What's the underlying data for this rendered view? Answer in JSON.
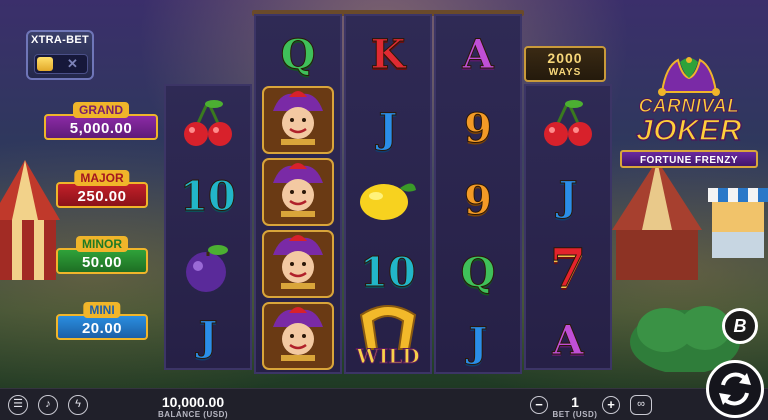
{
  "game": {
    "logo": {
      "line1": "CARNIVAL",
      "line2": "JOKER",
      "subtitle": "FORTUNE FRENZY"
    },
    "ways": {
      "count": "2000",
      "label": "WAYS"
    },
    "xtra_bet": {
      "title": "XTRA-BET",
      "enabled": false
    },
    "jackpots": [
      {
        "name": "GRAND",
        "value": "5,000.00"
      },
      {
        "name": "MAJOR",
        "value": "250.00"
      },
      {
        "name": "MINOR",
        "value": "50.00"
      },
      {
        "name": "MINI",
        "value": "20.00"
      }
    ],
    "reels": [
      [
        "cherries",
        "10",
        "plum",
        "J"
      ],
      [
        "Q",
        "joker",
        "joker",
        "joker",
        "joker"
      ],
      [
        "K",
        "J",
        "lemon",
        "10",
        "WILD"
      ],
      [
        "A",
        "9",
        "9",
        "Q",
        "J"
      ],
      [
        "cherries",
        "J",
        "7",
        "A"
      ]
    ],
    "wild_label": "WILD",
    "provider_badge": "B"
  },
  "bottom_bar": {
    "balance": {
      "value": "10,000.00",
      "label": "BALANCE (USD)"
    },
    "bet": {
      "value": "1",
      "label": "BET (USD)"
    },
    "icons": [
      "menu-icon",
      "sound-icon",
      "turbo-icon",
      "autoplay-icon",
      "spin-icon"
    ]
  }
}
